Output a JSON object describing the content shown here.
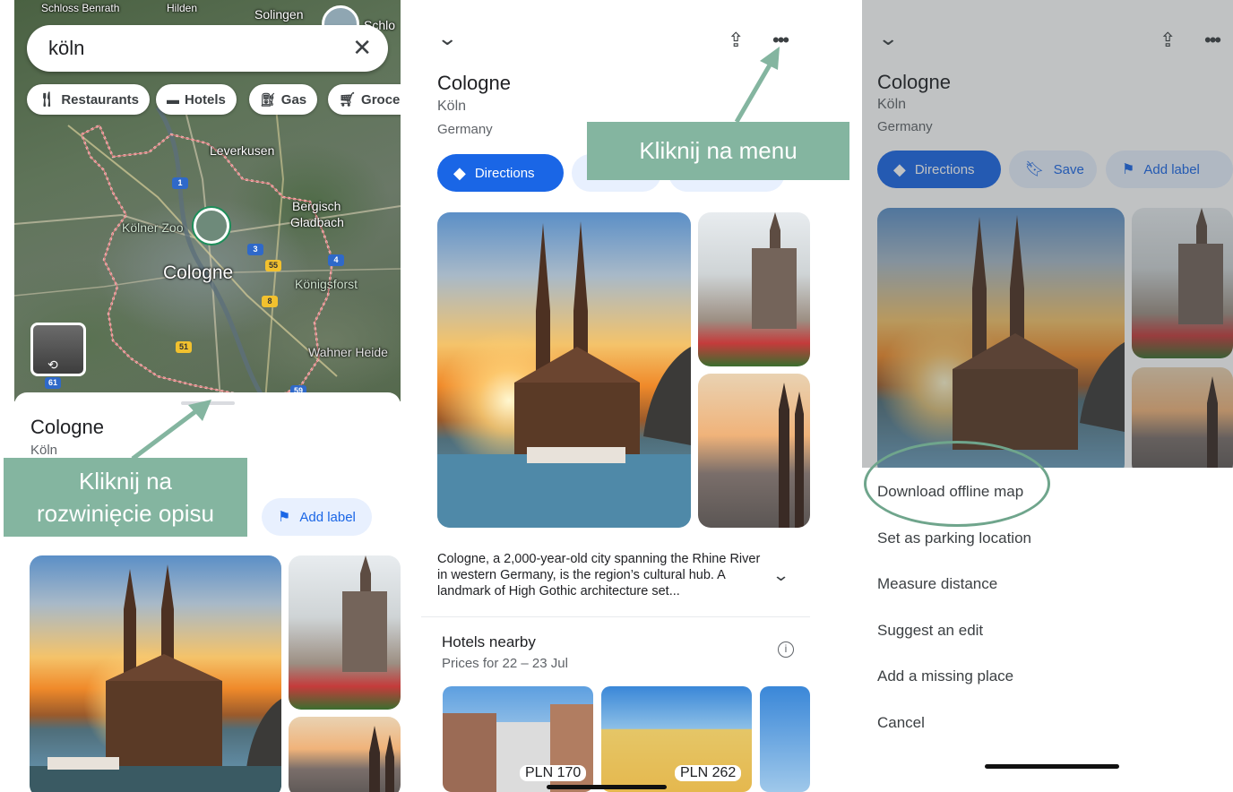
{
  "panel1": {
    "search": {
      "value": "köln"
    },
    "chips": [
      {
        "label": "Restaurants",
        "icon": "fork-knife-icon"
      },
      {
        "label": "Hotels",
        "icon": "bed-icon"
      },
      {
        "label": "Gas",
        "icon": "gas-pump-icon"
      },
      {
        "label": "Grocer",
        "icon": "cart-icon"
      }
    ],
    "map_labels": {
      "solingen": "Solingen",
      "hilden": "Hilden",
      "leverkusen": "Leverkusen",
      "bergisch": "Bergisch",
      "gladbach": "Gladbach",
      "zoo": "Kölner Zoo",
      "city": "Cologne",
      "konigsforst": "Königsforst",
      "wahner": "Wahner Heide",
      "top_left": "Schloss Benrath",
      "top_right": "Schlo"
    },
    "road_shields": [
      "1",
      "3",
      "55",
      "4",
      "8",
      "51",
      "61",
      "59"
    ],
    "place": {
      "title": "Cologne",
      "subtitle": "Köln"
    },
    "add_label": "Add label",
    "callout": "Kliknij na rozwinięcie opisu"
  },
  "panel2": {
    "title": "Cologne",
    "subtitle": "Köln",
    "country": "Germany",
    "directions": "Directions",
    "callout": "Kliknij na menu",
    "description": "Cologne, a 2,000-year-old city spanning the Rhine River in western Germany, is the region’s cultural hub. A landmark of High Gothic architecture set...",
    "hotels": {
      "title": "Hotels nearby",
      "subtitle": "Prices for 22 – 23 Jul",
      "prices": [
        "PLN 170",
        "PLN 262"
      ]
    }
  },
  "panel3": {
    "title": "Cologne",
    "subtitle": "Köln",
    "country": "Germany",
    "buttons": {
      "directions": "Directions",
      "save": "Save",
      "add_label": "Add label"
    },
    "menu": [
      "Download offline map",
      "Set as parking location",
      "Measure distance",
      "Suggest an edit",
      "Add a missing place",
      "Cancel"
    ]
  },
  "colors": {
    "accent_blue": "#1a66e6",
    "callout_green": "#84b5a0",
    "highlight_ring": "#6fa58c"
  }
}
